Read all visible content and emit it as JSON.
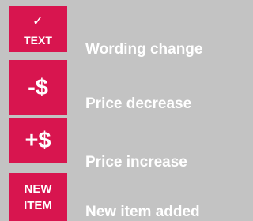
{
  "colors": {
    "badge": "#d8154f",
    "background": "#c3c3c3",
    "text": "#ffffff"
  },
  "legend": [
    {
      "icon": "checkmark-icon",
      "badge_top": "✓",
      "badge_text": "TEXT",
      "label": "Wording change"
    },
    {
      "badge_text": "-$",
      "label": "Price decrease"
    },
    {
      "badge_text": "+$",
      "label": "Price increase"
    },
    {
      "badge_line1": "NEW",
      "badge_line2": "ITEM",
      "label": "New item added"
    }
  ]
}
